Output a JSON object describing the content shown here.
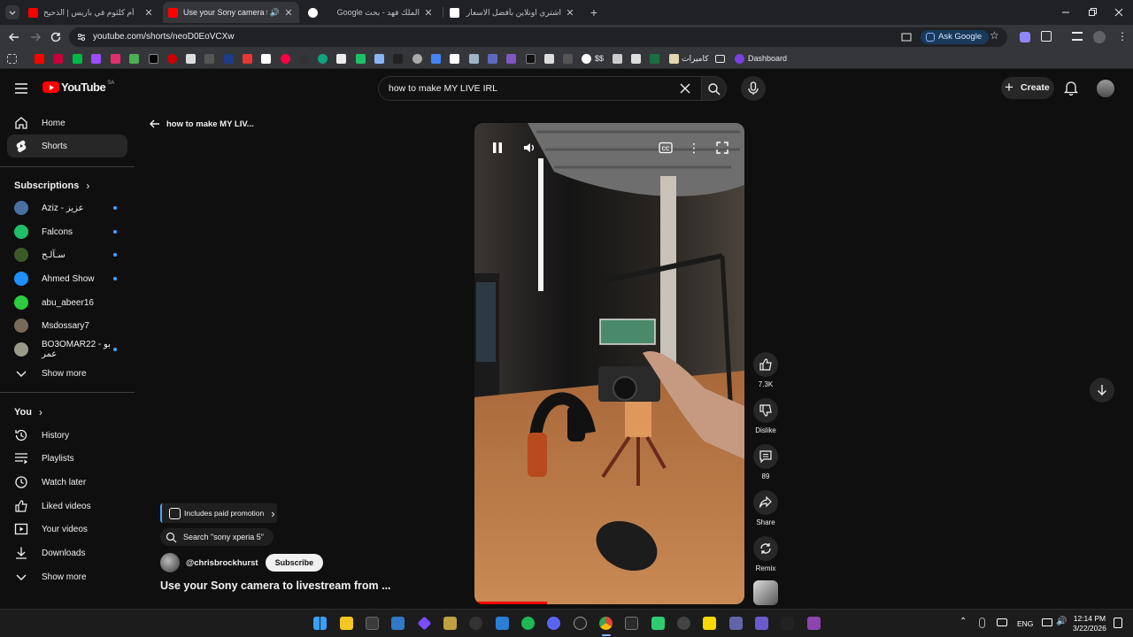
{
  "browser": {
    "tabs": [
      {
        "title": "أم كلثوم في باريس | الذحيح",
        "favicon_color": "#ff0000",
        "active": false
      },
      {
        "title": "Use your Sony camera to livestream",
        "favicon_color": "#ff0000",
        "active": true
      },
      {
        "title": "الملك فهد - بحث Google",
        "favicon_color": "#ffffff",
        "active": false
      },
      {
        "title": "اشتري اونلاين بأفضل الاسعار بالسعودية",
        "favicon_color": "#ffffff",
        "active": false
      }
    ],
    "url": "youtube.com/shorts/neoD0EoVCXw",
    "ask_google": "Ask Google",
    "bookmarks": {
      "dollar_label": "$$",
      "cameras_label": "كاميرات",
      "dashboard_label": "Dashboard"
    }
  },
  "masthead": {
    "logo_text": "YouTube",
    "region": "SA",
    "search_value": "how to make MY LIVE IRL",
    "create_label": "Create"
  },
  "sidebar": {
    "main": [
      {
        "label": "Home",
        "icon": "home-icon"
      },
      {
        "label": "Shorts",
        "icon": "shorts-icon",
        "active": true
      }
    ],
    "subscriptions_title": "Subscriptions",
    "subscriptions": [
      {
        "label": "Aziz - عزيز",
        "color": "#4a6fa5",
        "dot": true
      },
      {
        "label": "Falcons",
        "color": "#1fbf6a",
        "dot": true
      },
      {
        "label": "سـآلـح",
        "color": "#3a5a2a",
        "dot": true
      },
      {
        "label": "Ahmed Show",
        "color": "#1e90ff",
        "dot": true
      },
      {
        "label": "abu_abeer16",
        "color": "#2ecc40",
        "dot": false
      },
      {
        "label": "Msdossary7",
        "color": "#7a6a5a",
        "dot": false
      },
      {
        "label": "BO3OMAR22 - بو عمر",
        "color": "#9a9a8a",
        "dot": true
      }
    ],
    "show_more_1": "Show more",
    "you_title": "You",
    "you_items": [
      {
        "label": "History",
        "icon": "history-icon"
      },
      {
        "label": "Playlists",
        "icon": "playlists-icon"
      },
      {
        "label": "Watch later",
        "icon": "clock-icon"
      },
      {
        "label": "Liked videos",
        "icon": "thumbs-up-icon"
      },
      {
        "label": "Your videos",
        "icon": "video-icon"
      },
      {
        "label": "Downloads",
        "icon": "download-icon"
      }
    ],
    "show_more_2": "Show more"
  },
  "shorts": {
    "back_label": "how to make MY LIV...",
    "playback_progress": 0.27,
    "actions": {
      "likes": "7.3K",
      "dislike": "Dislike",
      "comments": "89",
      "share": "Share",
      "remix": "Remix"
    },
    "paid_promotion": "Includes paid promotion",
    "search_suggestion": "Search \"sony xperia 5\"",
    "channel": "@chrisbrockhurst",
    "subscribe": "Subscribe",
    "title": "Use your Sony camera to livestream from ..."
  },
  "taskbar": {
    "language": "ENG",
    "time": "12:14 PM",
    "date": "3/22/2026"
  }
}
